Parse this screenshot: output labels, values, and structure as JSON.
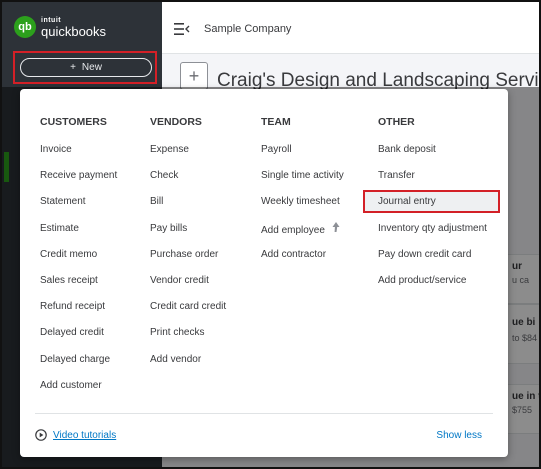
{
  "app": {
    "logo_top": "intuit",
    "logo_bottom": "quickbooks",
    "logo_badge": "qb",
    "company": "Sample Company",
    "new_button": "New",
    "page_title": "Craig's Design and Landscaping Services"
  },
  "background_cards": [
    {
      "t1": "ur",
      "t2": "u ca"
    },
    {
      "t1": "ue bi",
      "t2": "to $84"
    },
    {
      "t1": "ue in t",
      "t2": "$755"
    }
  ],
  "menu": {
    "columns": [
      {
        "header": "CUSTOMERS",
        "items": [
          "Invoice",
          "Receive payment",
          "Statement",
          "Estimate",
          "Credit memo",
          "Sales receipt",
          "Refund receipt",
          "Delayed credit",
          "Delayed charge",
          "Add customer"
        ]
      },
      {
        "header": "VENDORS",
        "items": [
          "Expense",
          "Check",
          "Bill",
          "Pay bills",
          "Purchase order",
          "Vendor credit",
          "Credit card credit",
          "Print checks",
          "Add vendor"
        ]
      },
      {
        "header": "TEAM",
        "items": [
          "Payroll",
          "Single time activity",
          "Weekly timesheet",
          "Add employee",
          "Add contractor"
        ]
      },
      {
        "header": "OTHER",
        "items": [
          "Bank deposit",
          "Transfer",
          "Journal entry",
          "Inventory qty adjustment",
          "Pay down credit card",
          "Add product/service"
        ]
      }
    ],
    "highlighted_item": "Journal entry",
    "footer": {
      "video_tutorials": "Video tutorials",
      "show_less": "Show less"
    }
  },
  "colors": {
    "sidebar": "#2d3238",
    "brand_green": "#2ca01c",
    "highlight_red": "#d32027",
    "link_blue": "#0077c5"
  },
  "icons": {
    "play": "play-circle-icon",
    "menu": "hamburger-menu-icon",
    "add": "plus-icon",
    "arrow": "arrow-up-icon"
  }
}
